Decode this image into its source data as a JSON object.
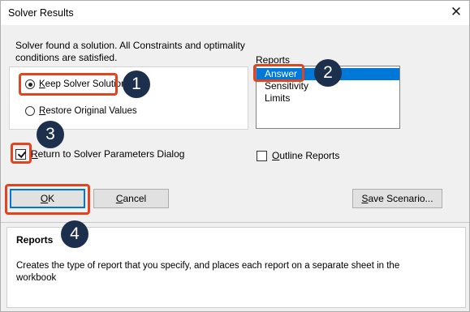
{
  "window": {
    "title": "Solver Results",
    "close_glyph": "✕"
  },
  "message": {
    "line1": "Solver found a solution.  All Constraints and optimality",
    "line2": "conditions are satisfied."
  },
  "options": {
    "keep_solution": {
      "label_prefix": "",
      "label_underlined": "K",
      "label_rest": "eep Solver Solution",
      "checked": true
    },
    "restore_original": {
      "label_prefix": "",
      "label_underlined": "R",
      "label_rest": "estore Original Values",
      "checked": false
    }
  },
  "reports": {
    "label": "Reports",
    "items": [
      "Answer",
      "Sensitivity",
      "Limits"
    ],
    "selected": "Answer"
  },
  "checkboxes": {
    "return_to_params": {
      "label_underlined": "R",
      "label_rest": "eturn to Solver Parameters Dialog",
      "checked": true
    },
    "outline_reports": {
      "label_underlined": "O",
      "label_rest": "utline Reports",
      "checked": false
    }
  },
  "buttons": {
    "ok": {
      "label_underlined": "O",
      "label_rest": "K"
    },
    "cancel": {
      "label_underlined": "C",
      "label_rest": "ancel"
    },
    "save_scenario": {
      "label_underlined": "S",
      "label_rest": "ave Scenario..."
    }
  },
  "help": {
    "title": "Reports",
    "line1": "Creates the type of report that you specify, and places each report on a separate sheet in the",
    "line2": "workbook"
  },
  "annotations": {
    "badges": [
      "1",
      "2",
      "3",
      "4"
    ],
    "highlight_color": "#e0451f",
    "badge_color": "#1c2f4d"
  },
  "colors": {
    "selection": "#0078d7",
    "dialog_bg": "#f0f0f0"
  }
}
